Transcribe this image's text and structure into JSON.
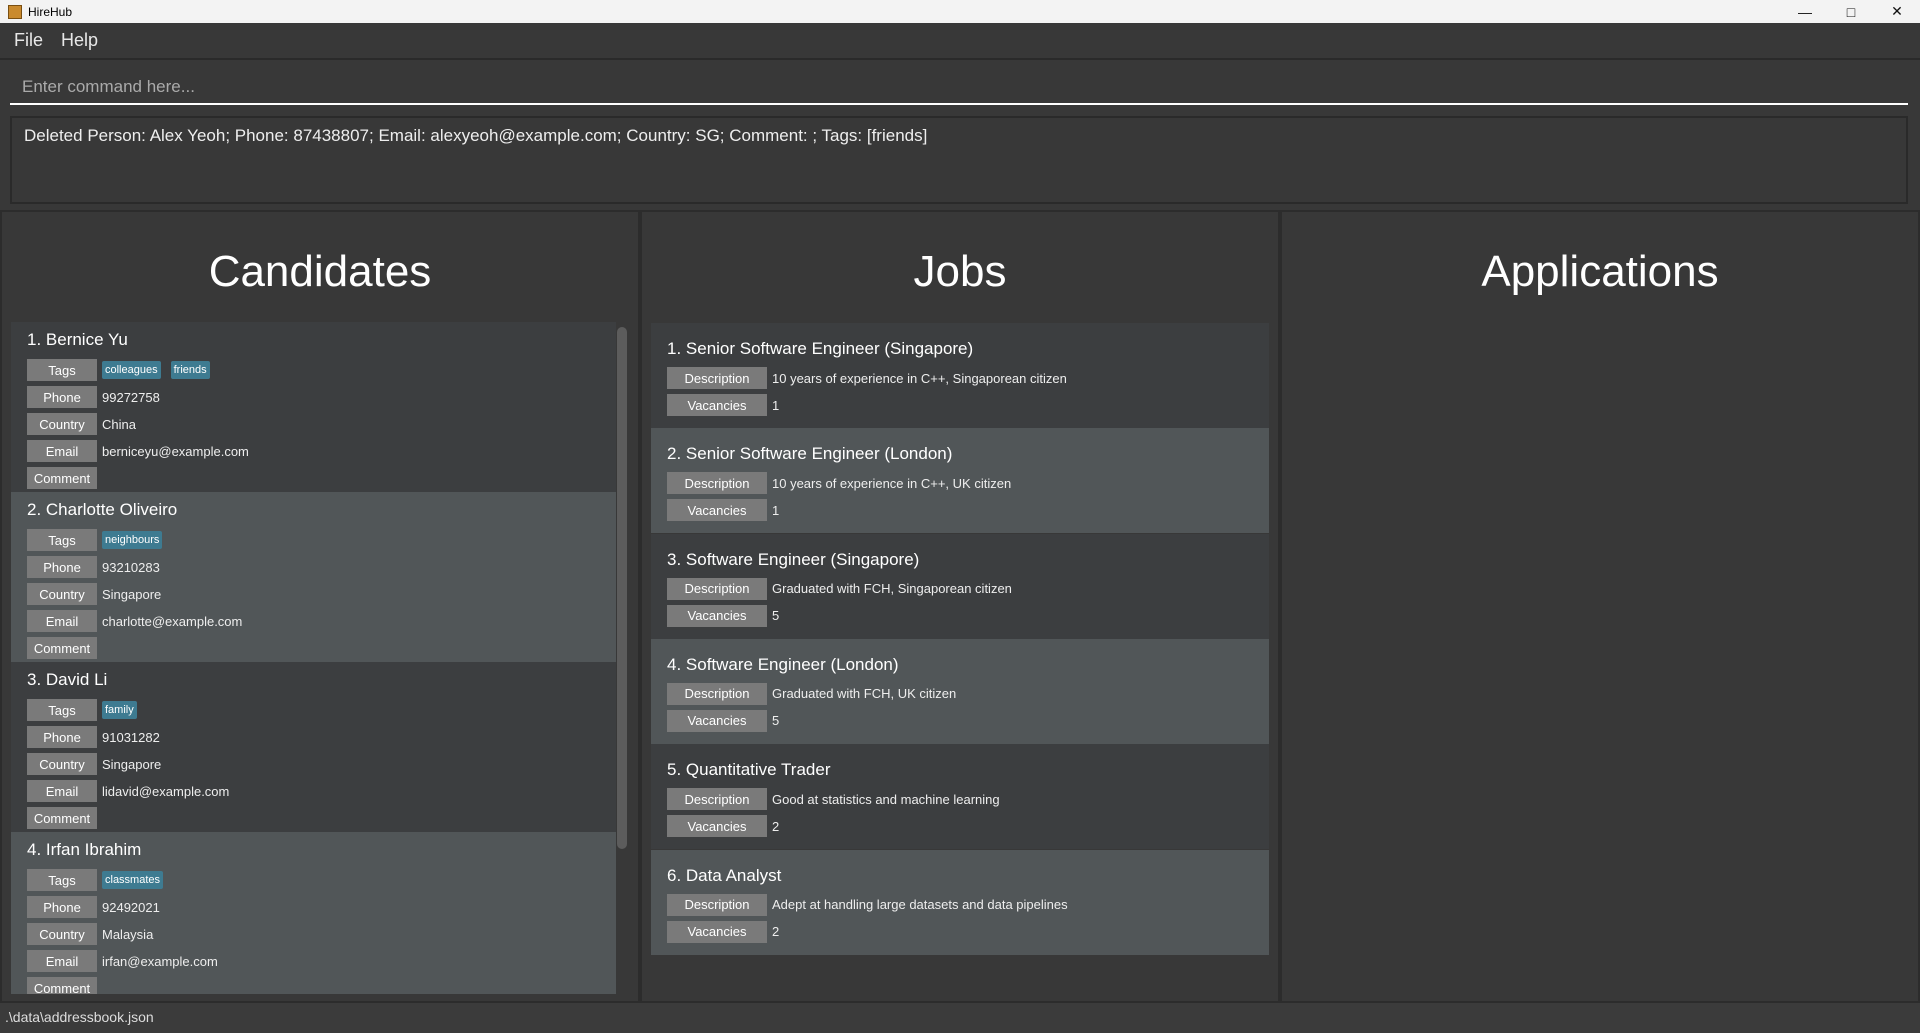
{
  "window": {
    "title": "HireHub"
  },
  "menu": [
    "File",
    "Help"
  ],
  "command": {
    "placeholder": "Enter command here...",
    "value": ""
  },
  "result": "Deleted Person: Alex Yeoh; Phone: 87438807; Email: alexyeoh@example.com; Country: SG; Comment: ; Tags: [friends]",
  "labels": {
    "tags": "Tags",
    "phone": "Phone",
    "country": "Country",
    "email": "Email",
    "comment": "Comment",
    "description": "Description",
    "vacancies": "Vacancies"
  },
  "panels": {
    "candidates": "Candidates",
    "jobs": "Jobs",
    "applications": "Applications"
  },
  "candidates": [
    {
      "name": "1.  Bernice Yu",
      "tags": [
        "colleagues",
        "friends"
      ],
      "phone": "99272758",
      "country": "China",
      "email": "berniceyu@example.com",
      "comment": ""
    },
    {
      "name": "2.  Charlotte Oliveiro",
      "tags": [
        "neighbours"
      ],
      "phone": "93210283",
      "country": "Singapore",
      "email": "charlotte@example.com",
      "comment": ""
    },
    {
      "name": "3.  David Li",
      "tags": [
        "family"
      ],
      "phone": "91031282",
      "country": "Singapore",
      "email": "lidavid@example.com",
      "comment": ""
    },
    {
      "name": "4.  Irfan Ibrahim",
      "tags": [
        "classmates"
      ],
      "phone": "92492021",
      "country": "Malaysia",
      "email": "irfan@example.com",
      "comment": ""
    }
  ],
  "jobs": [
    {
      "title": "1.  Senior Software Engineer (Singapore)",
      "description": "10 years of experience in C++, Singaporean citizen",
      "vacancies": "1"
    },
    {
      "title": "2.  Senior Software Engineer (London)",
      "description": "10 years of experience in C++, UK citizen",
      "vacancies": "1"
    },
    {
      "title": "3.  Software Engineer (Singapore)",
      "description": "Graduated with FCH, Singaporean citizen",
      "vacancies": "5"
    },
    {
      "title": "4.  Software Engineer (London)",
      "description": "Graduated with FCH, UK citizen",
      "vacancies": "5"
    },
    {
      "title": "5.  Quantitative Trader",
      "description": "Good at statistics and machine learning",
      "vacancies": "2"
    },
    {
      "title": "6.  Data Analyst",
      "description": "Adept at handling large datasets and data pipelines",
      "vacancies": "2"
    }
  ],
  "status": ".\\data\\addressbook.json",
  "colors": {
    "tag": "#3e7b91",
    "label": "#7a7a7a",
    "card_odd": "#3c3e40",
    "card_even": "#515658",
    "background": "#383838"
  }
}
